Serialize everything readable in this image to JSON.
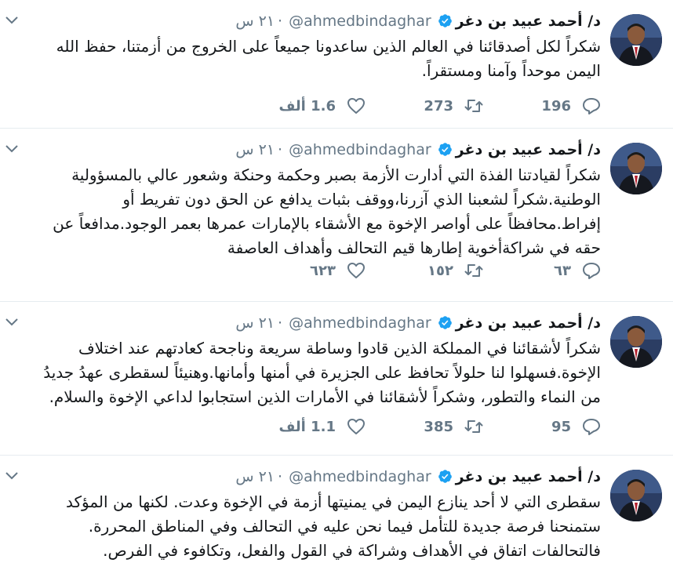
{
  "colors": {
    "text": "#14171a",
    "muted": "#657786",
    "verified": "#1da1f2",
    "divider": "#e6ecf0"
  },
  "tweets": [
    {
      "name": "د/ أحمد عبيد بن دغر",
      "handle": "@ahmedbindaghar",
      "sep": "·",
      "time": "٢١ س",
      "text": "شكراً لكل أصدقائنا في العالم الذين ساعدونا جميعاً على الخروج من أزمتنا، حفظ الله اليمن موحداً وآمنا ومستقراً.",
      "replies": "196",
      "retweets": "273",
      "likes": "1.6 ألف"
    },
    {
      "name": "د/ أحمد عبيد بن دغر",
      "handle": "@ahmedbindaghar",
      "sep": "·",
      "time": "٢١ س",
      "text": "شكراً لقيادتنا الفذة التي أدارت الأزمة بصبر وحكمة وحنكة وشعور عالي بالمسؤولية الوطنية.شكراً لشعبنا الذي آزرنا،ووقف بثبات يدافع عن الحق دون تفريط أو إفراط.محافظاً على أواصر الإخوة مع الأشقاء بالإمارات عمرها بعمر الوجود.مدافعاً عن حقه في شراكةأخوية إطارها قيم التحالف وأهداف العاصفة",
      "replies": "٦٣",
      "retweets": "١٥٢",
      "likes": "٦٢٣"
    },
    {
      "name": "د/ أحمد عبيد بن دغر",
      "handle": "@ahmedbindaghar",
      "sep": "·",
      "time": "٢١ س",
      "text": "شكراً لأشقائنا في المملكة الذين قادوا وساطة سريعة وناجحة كعادتهم عند اختلاف الإخوة.فسهلوا لنا حلولاً تحافظ على الجزيرة في أمنها وأمانها.وهنيئاً لسقطرى عهدُ جديدُ من النماء والتطور، وشكراً لأشقائنا في الأمارات الذين استجابوا لداعي الإخوة والسلام.",
      "replies": "95",
      "retweets": "385",
      "likes": "1.1 ألف"
    },
    {
      "name": "د/ أحمد عبيد بن دغر",
      "handle": "@ahmedbindaghar",
      "sep": "·",
      "time": "٢١ س",
      "text": "سقطرى التي لا أحد ينازع اليمن في يمنيتها أزمة في الإخوة وعدت. لكنها من المؤكد ستمنحنا فرصة جديدة للتأمل فيما نحن عليه في التحالف وفي المناطق المحررة. فالتحالفات اتفاق في الأهداف وشراكة في القول والفعل، وتكافوء في الفرص.",
      "replies": "",
      "retweets": "",
      "likes": ""
    }
  ]
}
